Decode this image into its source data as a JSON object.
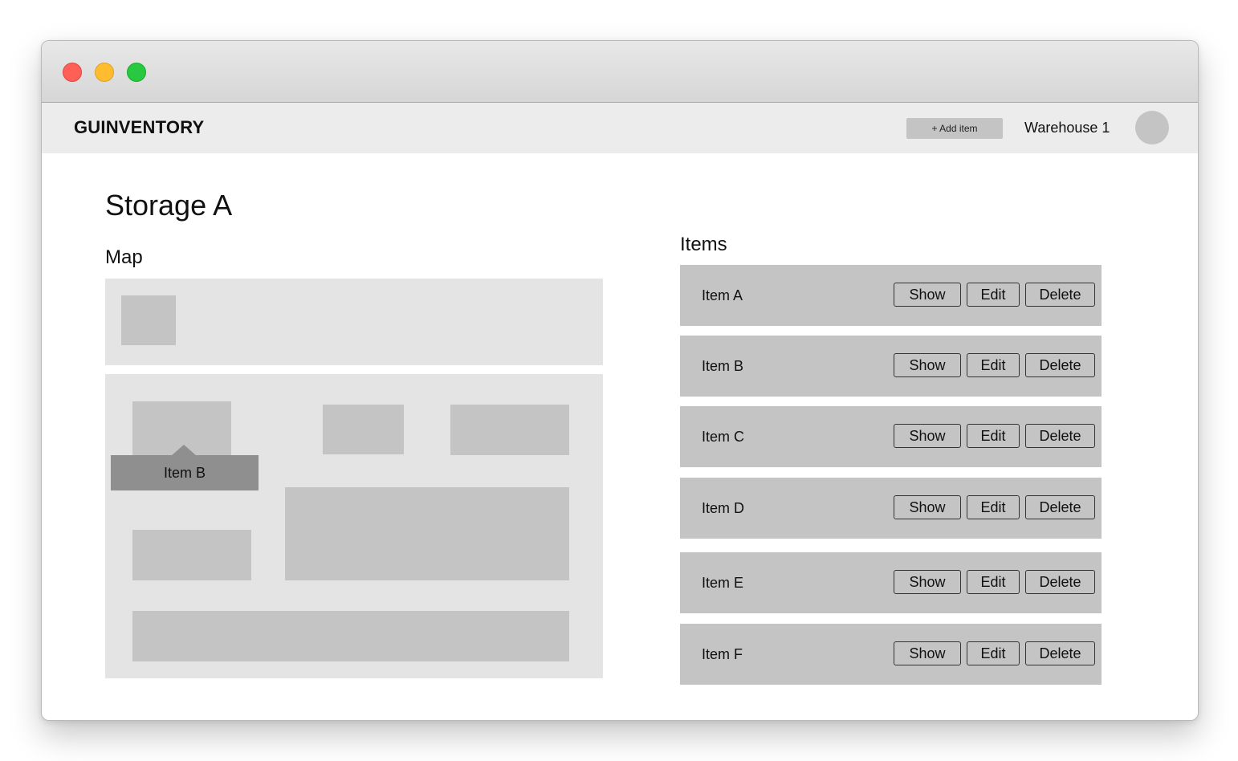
{
  "navbar": {
    "brand": "GUINVENTORY",
    "add_item_label": "+ Add item",
    "warehouse": "Warehouse 1"
  },
  "page": {
    "title": "Storage A",
    "map_label": "Map",
    "items_label": "Items"
  },
  "map": {
    "tooltip": "Item B"
  },
  "items": [
    {
      "name": "Item A",
      "show": "Show",
      "edit": "Edit",
      "delete": "Delete"
    },
    {
      "name": "Item B",
      "show": "Show",
      "edit": "Edit",
      "delete": "Delete"
    },
    {
      "name": "Item C",
      "show": "Show",
      "edit": "Edit",
      "delete": "Delete"
    },
    {
      "name": "Item D",
      "show": "Show",
      "edit": "Edit",
      "delete": "Delete"
    },
    {
      "name": "Item E",
      "show": "Show",
      "edit": "Edit",
      "delete": "Delete"
    },
    {
      "name": "Item F",
      "show": "Show",
      "edit": "Edit",
      "delete": "Delete"
    }
  ],
  "colors": {
    "close": "#fe5f57",
    "minimize": "#febc2e",
    "maximize": "#28c840",
    "placeholder": "#c4c4c4",
    "tooltip": "#8f8f8f"
  }
}
